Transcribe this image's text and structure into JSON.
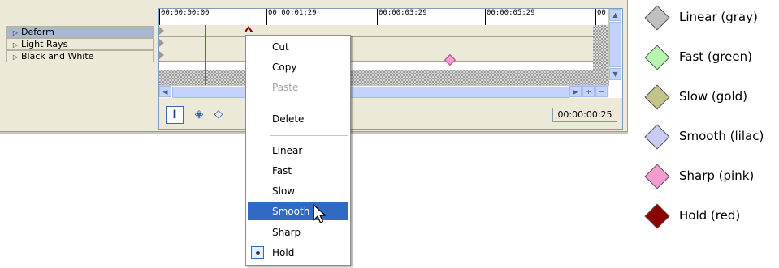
{
  "tracks": [
    {
      "label": "Deform",
      "selected": true
    },
    {
      "label": "Light Rays",
      "selected": false
    },
    {
      "label": "Black and White",
      "selected": false
    }
  ],
  "ruler": {
    "ticks": [
      "00:00:00:00",
      "00:00:01:29",
      "00:00:03:29",
      "00:00:05:29",
      "00"
    ]
  },
  "timecode": "00:00:00:25",
  "toolbar": {
    "buttons": [
      {
        "icon": "lock-envelope-icon"
      },
      {
        "icon": "first-keyframe-icon"
      },
      {
        "icon": "prev-keyframe-icon"
      }
    ]
  },
  "context_menu": {
    "groups": [
      [
        {
          "label": "Cut",
          "enabled": true
        },
        {
          "label": "Copy",
          "enabled": true
        },
        {
          "label": "Paste",
          "enabled": false
        }
      ],
      [
        {
          "label": "Delete",
          "enabled": true
        }
      ],
      [
        {
          "label": "Linear",
          "enabled": true
        },
        {
          "label": "Fast",
          "enabled": true
        },
        {
          "label": "Slow",
          "enabled": true
        },
        {
          "label": "Smooth",
          "enabled": true,
          "hover": true
        },
        {
          "label": "Sharp",
          "enabled": true
        },
        {
          "label": "Hold",
          "enabled": true,
          "checked": true
        }
      ]
    ]
  },
  "legend": [
    {
      "label": "Linear (gray)",
      "color": "#c0c0c0"
    },
    {
      "label": "Fast (green)",
      "color": "#b8f5b0"
    },
    {
      "label": "Slow (gold)",
      "color": "#c2c48a"
    },
    {
      "label": "Smooth (lilac)",
      "color": "#c9ccf5"
    },
    {
      "label": "Sharp (pink)",
      "color": "#f29ccf"
    },
    {
      "label": "Hold (red)",
      "color": "#8b0000"
    }
  ],
  "colors": {
    "selection": "#316ac5",
    "track_selected": "#a9b7d2",
    "hold_keyframe": "#8b0000",
    "sharp_keyframe": "#f39ad2"
  }
}
